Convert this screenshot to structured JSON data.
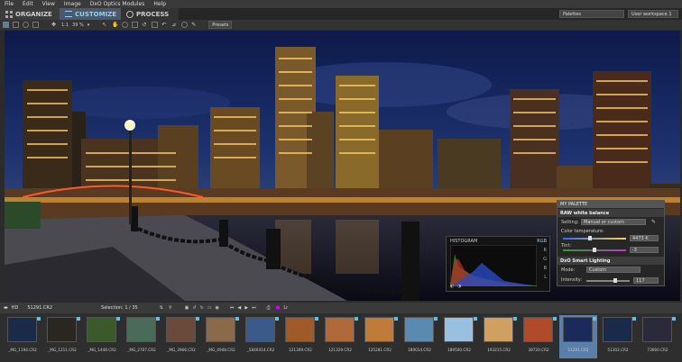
{
  "menu": [
    "File",
    "Edit",
    "View",
    "Image",
    "DxO Optics Modules",
    "Help"
  ],
  "workflow": {
    "tabs": [
      "ORGANIZE",
      "CUSTOMIZE",
      "PROCESS"
    ],
    "palettes_label": "Palettes",
    "workspace_label": "User workspace 1"
  },
  "toolbar": {
    "ratio": "1:1",
    "zoom": "39 %",
    "presets": "Presets"
  },
  "histogram": {
    "title": "HISTOGRAM",
    "mode": "RGB",
    "channels": [
      "R",
      "G",
      "B",
      "L"
    ]
  },
  "palette": {
    "title": "MY PALETTE",
    "wb": {
      "title": "RAW white balance",
      "setting_label": "Setting:",
      "setting_value": "Manual or custom",
      "temp_label": "Color temperature:",
      "temp_value": "4473 K",
      "tint_label": "Tint:",
      "tint_value": "-3"
    },
    "lighting": {
      "title": "DxO Smart Lighting",
      "mode_label": "Mode:",
      "mode_value": "Custom",
      "intensity_label": "Intensity:",
      "intensity_value": "117"
    }
  },
  "filmstrip": {
    "folder": "HD",
    "current_file": "51291.CR2",
    "selection": "Selection: 1 / 35",
    "thumbs": [
      {
        "label": "_MG_1194.CR2",
        "color": "#1a2a4a"
      },
      {
        "label": "_MG_1211.CR2",
        "color": "#2a2620"
      },
      {
        "label": "_MG_1448.CR2",
        "color": "#3a5a2a"
      },
      {
        "label": "_MG_2707.CR2",
        "color": "#4a6a5a"
      },
      {
        "label": "_MG_3966.CR2",
        "color": "#6a4a3a"
      },
      {
        "label": "_MG_4948.CR2",
        "color": "#8a6a4a"
      },
      {
        "label": "_5846414.CR2",
        "color": "#3a5a8a"
      },
      {
        "label": "121309.CR2",
        "color": "#a05a2a"
      },
      {
        "label": "121329.CR2",
        "color": "#b06a3a"
      },
      {
        "label": "125281.CR2",
        "color": "#c07a3a"
      },
      {
        "label": "189014.CR2",
        "color": "#5a8ab0"
      },
      {
        "label": "189500.CR2",
        "color": "#9ac0e0"
      },
      {
        "label": "193215.CR2",
        "color": "#d0a060"
      },
      {
        "label": "38720.CR2",
        "color": "#b04a2a"
      },
      {
        "label": "51291.CR2",
        "color": "#1a2a5a"
      },
      {
        "label": "51302.CR2",
        "color": "#1a2a4a"
      },
      {
        "label": "73660.CR2",
        "color": "#2a2a3a"
      }
    ]
  }
}
